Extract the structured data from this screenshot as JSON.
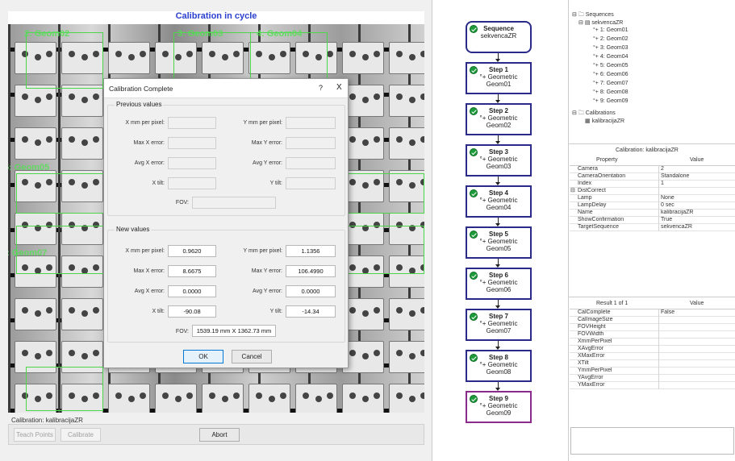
{
  "left": {
    "title": "Calibration in cycle",
    "roi_labels": [
      "2: Geom02",
      "3: Geom03",
      "4: Geom04",
      "5: Geom05",
      "7: Geom07"
    ],
    "calibration_status": "Calibration: kalibracijaZR",
    "buttons": {
      "teach_points": "Teach Points",
      "calibrate": "Calibrate",
      "abort": "Abort"
    }
  },
  "dialog": {
    "title": "Calibration Complete",
    "help": "?",
    "close": "X",
    "previous": {
      "group_label": "Previous values",
      "x_mm_per_pixel_label": "X mm per pixel:",
      "y_mm_per_pixel_label": "Y mm per pixel:",
      "max_x_error_label": "Max X error:",
      "max_y_error_label": "Max Y error:",
      "avg_x_error_label": "Avg X error:",
      "avg_y_error_label": "Avg Y error:",
      "x_tilt_label": "X tilt:",
      "y_tilt_label": "Y tilt:",
      "fov_label": "FOV:"
    },
    "new": {
      "group_label": "New values",
      "x_mm_per_pixel_label": "X mm per pixel:",
      "x_mm_per_pixel": "0.9620",
      "y_mm_per_pixel_label": "Y mm per pixel:",
      "y_mm_per_pixel": "1.1356",
      "max_x_error_label": "Max X error:",
      "max_x_error": "8.6675",
      "max_y_error_label": "Max Y error:",
      "max_y_error": "106.4990",
      "avg_x_error_label": "Avg X error:",
      "avg_x_error": "0.0000",
      "avg_y_error_label": "Avg Y error:",
      "avg_y_error": "0.0000",
      "x_tilt_label": "X tilt:",
      "x_tilt": "-90.08",
      "y_tilt_label": "Y tilt:",
      "y_tilt": "-14.34",
      "fov_label": "FOV:",
      "fov": "1539.19 mm X 1362.73 mm"
    },
    "ok": "OK",
    "cancel": "Cancel"
  },
  "flow": {
    "sequence": {
      "title": "Sequence",
      "name": "sekvencaZR"
    },
    "steps": [
      {
        "title": "Step 1",
        "type": "Geometric",
        "name": "Geom01"
      },
      {
        "title": "Step 2",
        "type": "Geometric",
        "name": "Geom02"
      },
      {
        "title": "Step 3",
        "type": "Geometric",
        "name": "Geom03"
      },
      {
        "title": "Step 4",
        "type": "Geometric",
        "name": "Geom04"
      },
      {
        "title": "Step 5",
        "type": "Geometric",
        "name": "Geom05"
      },
      {
        "title": "Step 6",
        "type": "Geometric",
        "name": "Geom06"
      },
      {
        "title": "Step 7",
        "type": "Geometric",
        "name": "Geom07"
      },
      {
        "title": "Step 8",
        "type": "Geometric",
        "name": "Geom08"
      },
      {
        "title": "Step 9",
        "type": "Geometric",
        "name": "Geom09"
      }
    ],
    "accent": "#2a2a88",
    "selected_accent": "#8a2a8a"
  },
  "tree": {
    "sequences": "Sequences",
    "sequence_name": "sekvencaZR",
    "items": [
      "1: Geom01",
      "2: Geom02",
      "3: Geom03",
      "4: Geom04",
      "5: Geom05",
      "6: Geom06",
      "7: Geom07",
      "8: Geom08",
      "9: Geom09"
    ],
    "calibrations": "Calibrations",
    "calibration_name": "kalibracijaZR"
  },
  "props": {
    "caption": "Calibration: kalibracijaZR",
    "col_property": "Property",
    "col_value": "Value",
    "rows": [
      {
        "p": "Camera",
        "v": "2"
      },
      {
        "p": "CameraOrientation",
        "v": "Standalone"
      },
      {
        "p": "Index",
        "v": "1"
      },
      {
        "p": "DistCorrect",
        "v": ""
      },
      {
        "p": "Lamp",
        "v": "None"
      },
      {
        "p": "LampDelay",
        "v": "0 sec"
      },
      {
        "p": "Name",
        "v": "kalibracijaZR"
      },
      {
        "p": "ShowConfirmation",
        "v": "True"
      },
      {
        "p": "TargetSequence",
        "v": "sekvencaZR"
      }
    ]
  },
  "results": {
    "caption": "Result 1 of 1",
    "col_value": "Value",
    "rows": [
      {
        "p": "CalComplete",
        "v": "False"
      },
      {
        "p": "CalImageSize",
        "v": ""
      },
      {
        "p": "FOVHeight",
        "v": ""
      },
      {
        "p": "FOVWidth",
        "v": ""
      },
      {
        "p": "XmmPerPixel",
        "v": ""
      },
      {
        "p": "XAvgError",
        "v": ""
      },
      {
        "p": "XMaxError",
        "v": ""
      },
      {
        "p": "XTilt",
        "v": ""
      },
      {
        "p": "YmmPerPixel",
        "v": ""
      },
      {
        "p": "YAvgError",
        "v": ""
      },
      {
        "p": "YMaxError",
        "v": ""
      }
    ]
  }
}
